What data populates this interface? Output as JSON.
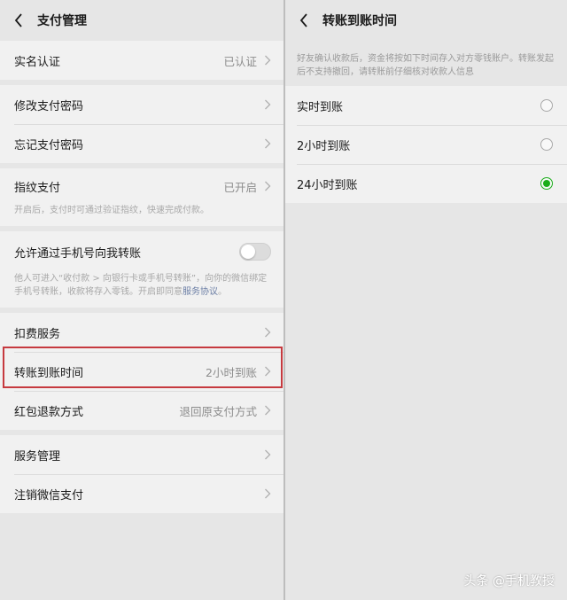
{
  "left": {
    "header": {
      "title": "支付管理"
    },
    "items": {
      "real_name": {
        "label": "实名认证",
        "value": "已认证"
      },
      "change_pwd": {
        "label": "修改支付密码"
      },
      "forgot_pwd": {
        "label": "忘记支付密码"
      },
      "fingerprint": {
        "label": "指纹支付",
        "value": "已开启",
        "desc": "开启后，支付时可通过验证指纹，快速完成付款。"
      },
      "phone_transfer": {
        "label": "允许通过手机号向我转账",
        "toggle": false,
        "desc_main": "他人可进入“收付款 > 向银行卡或手机号转账”，向你的微信绑定手机号转账，收款将存入零钱。开启即同意",
        "desc_link": "服务协议",
        "desc_end": "。"
      },
      "deduction": {
        "label": "扣费服务"
      },
      "transfer_time": {
        "label": "转账到账时间",
        "value": "2小时到账"
      },
      "red_packet_refund": {
        "label": "红包退款方式",
        "value": "退回原支付方式"
      },
      "service_mgmt": {
        "label": "服务管理"
      },
      "cancel_pay": {
        "label": "注销微信支付"
      }
    }
  },
  "right": {
    "header": {
      "title": "转账到账时间"
    },
    "intro": "好友确认收款后，资金将按如下时间存入对方零钱账户。转账发起后不支持撤回，请转账前仔细核对收款人信息",
    "options": [
      {
        "label": "实时到账",
        "selected": false
      },
      {
        "label": "2小时到账",
        "selected": false
      },
      {
        "label": "24小时到账",
        "selected": true
      }
    ]
  },
  "watermark": "头条 @手机教授",
  "colors": {
    "accent_green": "#1aad19",
    "highlight_red": "#c63a3f",
    "link_blue": "#6b7ea5"
  },
  "icons": {
    "back": "chevron-left-icon",
    "row_arrow": "chevron-right-icon",
    "radio": "radio-icon",
    "toggle": "toggle-switch"
  }
}
